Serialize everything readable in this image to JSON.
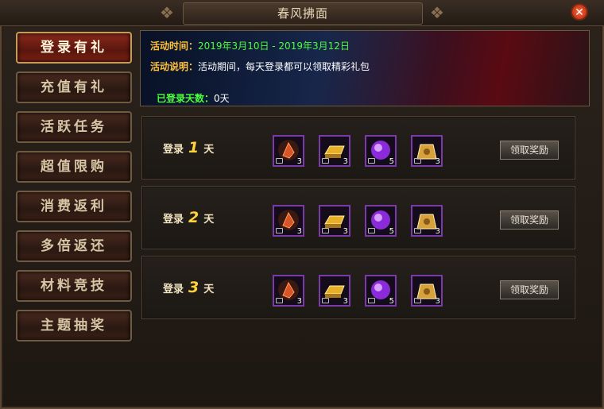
{
  "window": {
    "title": "春风拂面",
    "close_label": "✕"
  },
  "sidebar": {
    "tabs": [
      {
        "label": "登录有礼",
        "active": true
      },
      {
        "label": "充值有礼",
        "active": false
      },
      {
        "label": "活跃任务",
        "active": false
      },
      {
        "label": "超值限购",
        "active": false
      },
      {
        "label": "消费返利",
        "active": false
      },
      {
        "label": "多倍返还",
        "active": false
      },
      {
        "label": "材料竞技",
        "active": false
      },
      {
        "label": "主题抽奖",
        "active": false
      }
    ]
  },
  "banner": {
    "time_label": "活动时间：",
    "time_value": "2019年3月10日 - 2019年3月12日",
    "desc_label": "活动说明：",
    "desc_value": "活动期间，每天登录都可以领取精彩礼包",
    "days_label": "已登录天数：",
    "days_value": "0天"
  },
  "rewards": [
    {
      "prefix": "登录",
      "day": "1",
      "suffix": "天",
      "button": "领取奖励",
      "items": [
        {
          "icon": "red-crystal-icon",
          "count": "3"
        },
        {
          "icon": "gold-bar-icon",
          "count": "3"
        },
        {
          "icon": "purple-orb-icon",
          "count": "5"
        },
        {
          "icon": "gold-token-icon",
          "count": "3"
        }
      ]
    },
    {
      "prefix": "登录",
      "day": "2",
      "suffix": "天",
      "button": "领取奖励",
      "items": [
        {
          "icon": "red-crystal-icon",
          "count": "3"
        },
        {
          "icon": "gold-bar-icon",
          "count": "3"
        },
        {
          "icon": "purple-orb-icon",
          "count": "5"
        },
        {
          "icon": "gold-token-icon",
          "count": "3"
        }
      ]
    },
    {
      "prefix": "登录",
      "day": "3",
      "suffix": "天",
      "button": "领取奖励",
      "items": [
        {
          "icon": "red-crystal-icon",
          "count": "3"
        },
        {
          "icon": "gold-bar-icon",
          "count": "3"
        },
        {
          "icon": "purple-orb-icon",
          "count": "5"
        },
        {
          "icon": "gold-token-icon",
          "count": "3"
        }
      ]
    }
  ],
  "colors": {
    "accent_gold": "#ffc23a",
    "days_green": "#4cff3c",
    "item_border": "#7a3aa8"
  }
}
